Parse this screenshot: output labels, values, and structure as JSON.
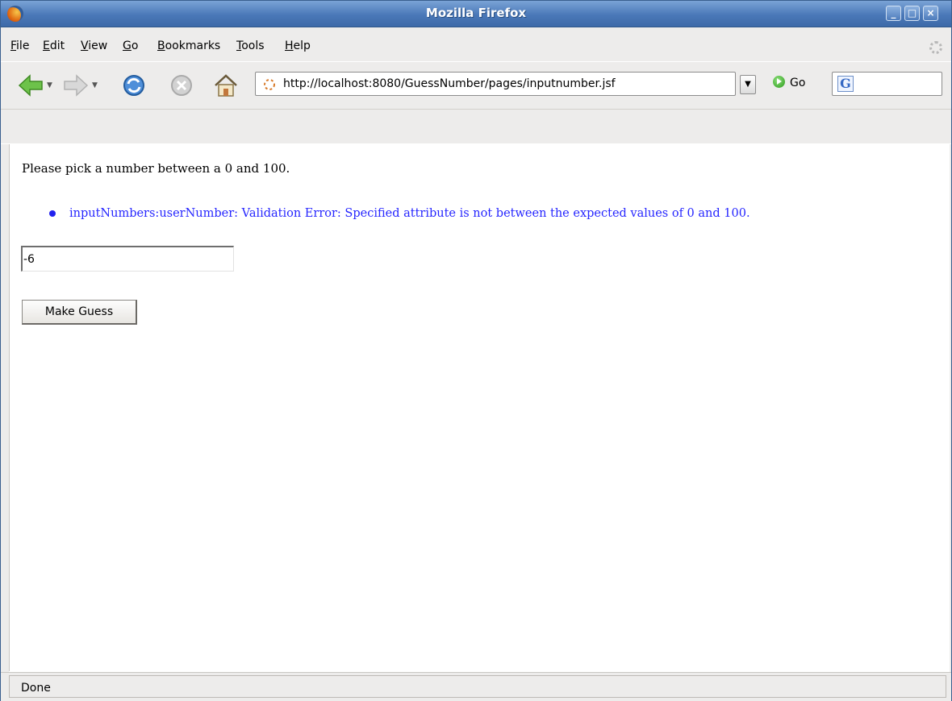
{
  "window": {
    "title": "Mozilla Firefox",
    "controls": {
      "minimize": "_",
      "maximize": "□",
      "close": "×"
    }
  },
  "menubar": {
    "items": [
      {
        "label": "File",
        "mnemonic": "F",
        "rest": "ile"
      },
      {
        "label": "Edit",
        "mnemonic": "E",
        "rest": "dit"
      },
      {
        "label": "View",
        "mnemonic": "V",
        "rest": "iew"
      },
      {
        "label": "Go",
        "mnemonic": "G",
        "rest": "o"
      },
      {
        "label": "Bookmarks",
        "mnemonic": "B",
        "rest": "ookmarks"
      },
      {
        "label": "Tools",
        "mnemonic": "T",
        "rest": "ools"
      },
      {
        "label": "Help",
        "mnemonic": "H",
        "rest": "elp"
      }
    ]
  },
  "toolbar": {
    "icons": [
      "back-arrow-icon",
      "forward-arrow-icon",
      "reload-icon",
      "stop-icon",
      "home-icon"
    ],
    "url": "http://localhost:8080/GuessNumber/pages/inputnumber.jsf",
    "go_label": "Go",
    "search_engine_letter": "G"
  },
  "page": {
    "prompt": "Please pick a number between a 0 and 100.",
    "error_message": "inputNumbers:userNumber: Validation Error: Specified attribute is not between the expected values of 0 and 100.",
    "input_value": "-6",
    "submit_label": "Make Guess"
  },
  "statusbar": {
    "text": "Done"
  },
  "colors": {
    "titlebar": "#4a78b8",
    "error_text": "#2626ff",
    "chrome": "#edeceb"
  }
}
